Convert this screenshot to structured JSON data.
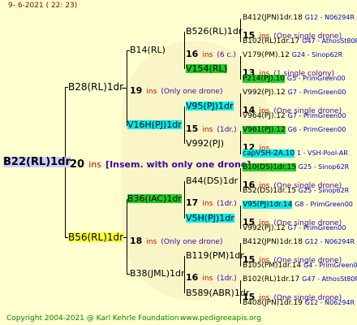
{
  "header": {
    "date_line": "9- 6-2021 ( 22: 23)"
  },
  "footer": {
    "copyright": "Copyright 2004-2021 @ Karl Kehrle Foundation",
    "url": "www.pedigreeapis.org"
  },
  "root": {
    "name": "B22(RL)1dr",
    "num": "20",
    "ins": "ins",
    "note": "[Insem. with only one drone]"
  },
  "sire": {
    "name": "B28(RL)1dr",
    "num": "19",
    "ins": "ins",
    "note": "(Only one drone)"
  },
  "dam": {
    "name": "B56(RL)1dr",
    "num": "18",
    "ins": "ins",
    "note": "(Only one drone)"
  },
  "level2": {
    "b14": {
      "name": "B14(RL)",
      "num": "16",
      "ins": "ins",
      "note": "(6 c.)"
    },
    "v16h": {
      "name": "V16H(PJ)1dr",
      "num": "15",
      "ins": "ins",
      "note": "(1dr.)"
    },
    "b36": {
      "name": "B36(IAC)1dr",
      "num": "17",
      "ins": "ins",
      "note": "(1dr.)"
    },
    "b38": {
      "name": "B38(JML)1dr",
      "num": "16",
      "ins": "ins",
      "note": "(1dr.)"
    }
  },
  "level3": {
    "b526": {
      "name": "B526(RL)1dr",
      "num": "",
      "ins": "",
      "note": ""
    },
    "v154": {
      "name": "V154(RL)",
      "num": "13",
      "ins": "ins",
      "note": "(1 single colony)"
    },
    "v95a": {
      "name": "V95(PJ)1dr",
      "num": "14",
      "ins": "ins",
      "note": "(One single drone)"
    },
    "v992a": {
      "name": "V992(PJ)",
      "num": "12",
      "ins": "ins",
      "note": ""
    },
    "b44": {
      "name": "B44(DS)1dr",
      "num": "16",
      "ins": "ins",
      "note": "(One single drone)"
    },
    "v5h": {
      "name": "V5H(PJ)1dr",
      "num": "15",
      "ins": "ins",
      "note": "(One single drone)"
    },
    "b119": {
      "name": "B119(PM)1dr",
      "num": "15",
      "ins": "ins",
      "note": "(One single drone)"
    },
    "b589": {
      "name": "B589(ABR)1dr",
      "num": "15",
      "ins": "ins",
      "note": "(One single drone)"
    }
  },
  "b526_info": {
    "num": "15",
    "ins": "ins",
    "note": "(One single drone)"
  },
  "leaves": [
    {
      "name": "B412(JPN)1dr.18",
      "info": "G12 - N06294R"
    },
    {
      "name": "B102(RL)1dr.17",
      "info": "G47 - AthosSt80R"
    },
    {
      "name": "V179(PM).12",
      "info": "G24 - Sinop62R"
    },
    {
      "name": "P214(PJ).10",
      "info": "G5 - PrimGreen00"
    },
    {
      "name": "V992(PJ).12",
      "info": "G7 - PrimGreen00"
    },
    {
      "name": "V964(PJ).12",
      "info": "G7 - PrimGreen00"
    },
    {
      "name": "V961(PJ).12",
      "info": "G6 - PrimGreen00"
    },
    {
      "name": "capVSH-2A.10",
      "info": "1 - VSH-Pool-AR"
    },
    {
      "name": "B10(DS)1dr.15",
      "info": "G25 - Sinop62R"
    },
    {
      "name": "B52(DS)1dr.15",
      "info": "G25 - Sinop62R"
    },
    {
      "name": "V95(PJ)1dr.14",
      "info": "G8 - PrimGreen00"
    },
    {
      "name": "V992(PJ).12",
      "info": "G7 - PrimGreen00"
    },
    {
      "name": "B412(JPN)1dr.18",
      "info": "G12 - N06294R"
    },
    {
      "name": "B105(PM)1dr.14",
      "info": "G4 - PrimGreen00"
    },
    {
      "name": "B102(RL)1dr.17",
      "info": "G47 - AthosSt80R"
    },
    {
      "name": "B408(JPN)1dr.19",
      "info": "G12 - N06294R"
    }
  ]
}
